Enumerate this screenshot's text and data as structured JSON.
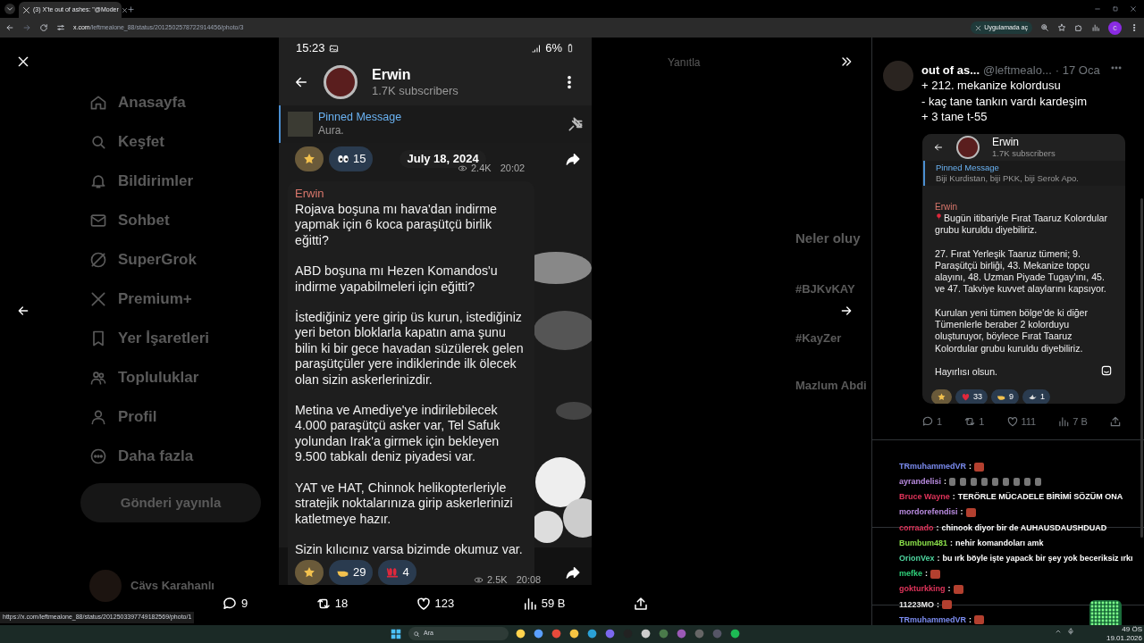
{
  "browser": {
    "tab_title": "(3) X'te out of ashes: \"@Moder",
    "url_domain": "x.com",
    "url_path": "/leftmealone_88/status/2012502578722914456/photo/3",
    "open_in_app": "Uygulamada aç",
    "profile_initial": "c"
  },
  "sidebar": {
    "items": [
      "Anasayfa",
      "Keşfet",
      "Bildirimler",
      "Sohbet",
      "SuperGrok",
      "Premium+",
      "Yer İşaretleri",
      "Topluluklar",
      "Profil",
      "Daha fazla"
    ],
    "post_button": "Gönderi yayınla",
    "account_name": "Cävs Karahanlı"
  },
  "background_texts": [
    "Yanıtla",
    "Neler oluy",
    "#BJKvKAY",
    "#KayZer",
    "Mazlum Abdi"
  ],
  "photo": {
    "status_time": "15:23",
    "battery": "6%",
    "channel": "Erwin",
    "subscribers": "1.7K subscribers",
    "pinned_title": "Pinned Message",
    "pinned_text": "Aura.",
    "top_reactions": [
      {
        "kind": "star"
      },
      {
        "kind": "eyes",
        "count": "15"
      }
    ],
    "date_chip": "July 18, 2024",
    "top_views": "2.4K",
    "top_time": "20:02",
    "sender": "Erwin",
    "paragraphs": [
      "Rojava boşuna mı hava'dan indirme yapmak için 6 koca paraşütçü birlik eğitti?",
      "ABD boşuna mı Hezen Komandos'u indirme yapabilmeleri için eğitti?",
      "İstediğiniz yere girip üs kurun, istediğiniz yeri beton bloklarla kapatın ama şunu bilin ki bir gece havadan süzülerek gelen paraşütçüler yere indiklerinde ilk ölecek olan sizin askerlerinizdir.",
      "Metina ve Amediye'ye indirilebilecek 4.000 paraşütçü asker var, Tel Safuk yolundan Irak'a girmek için bekleyen 9.500 tabkalı deniz piyadesi var.",
      "YAT ve HAT, Chinnok helikopterleriyle stratejik noktalarınıza girip askerlerinizi katletmeye hazır.",
      "Sizin kılıcınız varsa bizimde okumuz var."
    ],
    "bottom_reactions": [
      {
        "kind": "star"
      },
      {
        "kind": "hand",
        "count": "29"
      },
      {
        "kind": "hundred",
        "count": "4"
      }
    ],
    "bottom_views": "2.5K",
    "bottom_time": "20:08"
  },
  "photo_actions": {
    "replies": "9",
    "reposts": "18",
    "likes": "123",
    "views": "59 B"
  },
  "status_url": "https://x.com/leftmealone_88/status/2012503397749182569/photo/1",
  "tweet": {
    "name": "out of as...",
    "handle": "@leftmealo...",
    "time": "· 17 Oca",
    "lines": [
      "+ 212. mekanize kolordusu",
      "- kaç tane tankın vardı kardeşim",
      "+ 3 tane t-55"
    ],
    "embed": {
      "channel": "Erwin",
      "subscribers": "1.7K subscribers",
      "pinned_title": "Pinned Message",
      "pinned_text": "Biji Kurdistan, biji PKK, biji Serok Apo.",
      "sender": "Erwin",
      "paragraphs": [
        "Bugün itibariyle Fırat Taaruz Kolordular grubu kuruldu diyebiliriz.",
        "27. Fırat Yerleşik Taaruz tümeni; 9. Paraşütçü birliği, 43. Mekanize topçu alayını, 48. Uzman Piyade Tugay'ını, 45. ve 47. Takviye kuvvet alaylarını kapsıyor.",
        "Kurulan yeni tümen bölge'de ki diğer Tümenlerle beraber 2 kolorduyu oluşturuyor, böylece Fırat Taaruz Kolordular grubu kuruldu diyebiliriz.",
        "Hayırlısı olsun."
      ],
      "reactions": [
        {
          "kind": "star"
        },
        {
          "kind": "heart",
          "count": "33"
        },
        {
          "kind": "hand",
          "count": "9"
        },
        {
          "kind": "dove",
          "count": "1"
        }
      ]
    },
    "actions": {
      "replies": "1",
      "reposts": "1",
      "likes": "111",
      "views": "7 B"
    }
  },
  "chat": [
    {
      "user": "TRmuhammedVR",
      "color": "#7b8cf0",
      "separator": ":",
      "kind": "emote"
    },
    {
      "user": "ayrandelisi",
      "color": "#b98be0",
      "separator": ":",
      "kind": "emotes"
    },
    {
      "user": "Bruce Wayne",
      "color": "#e0335a",
      "separator": ":",
      "kind": "text",
      "text": "TERÖRLE MÜCADELE BİRİMİ SÖZÜM ONA"
    },
    {
      "user": "mordorefendisi",
      "color": "#b98be0",
      "separator": ":",
      "kind": "emote"
    },
    {
      "user": "corraado",
      "color": "#e0335a",
      "separator": ":",
      "kind": "text",
      "text": "chinook diyor bir de AUHAUSDAUSHDUAD"
    },
    {
      "user": "Bumbum481",
      "color": "#8be04a",
      "separator": ":",
      "kind": "text",
      "text": "nehir komandoları amk"
    },
    {
      "user": "OrionVex",
      "color": "#4fd6a0",
      "separator": ":",
      "kind": "text",
      "text": "bu ırk böyle işte yapack bir şey yok beceriksiz ırkı"
    },
    {
      "user": "mefke",
      "color": "#2fd07a",
      "separator": ":",
      "kind": "emote"
    },
    {
      "user": "gokturkking",
      "color": "#e0335a",
      "separator": ":",
      "kind": "emote"
    },
    {
      "user": "11223MO",
      "color": "#e8e8e8",
      "separator": ":",
      "kind": "emote"
    },
    {
      "user": "TRmuhammedVR",
      "color": "#7b8cf0",
      "separator": ":",
      "kind": "emote"
    }
  ],
  "taskbar": {
    "search": "Ara",
    "time": "49 ÖS",
    "date": "19.01.2026"
  }
}
